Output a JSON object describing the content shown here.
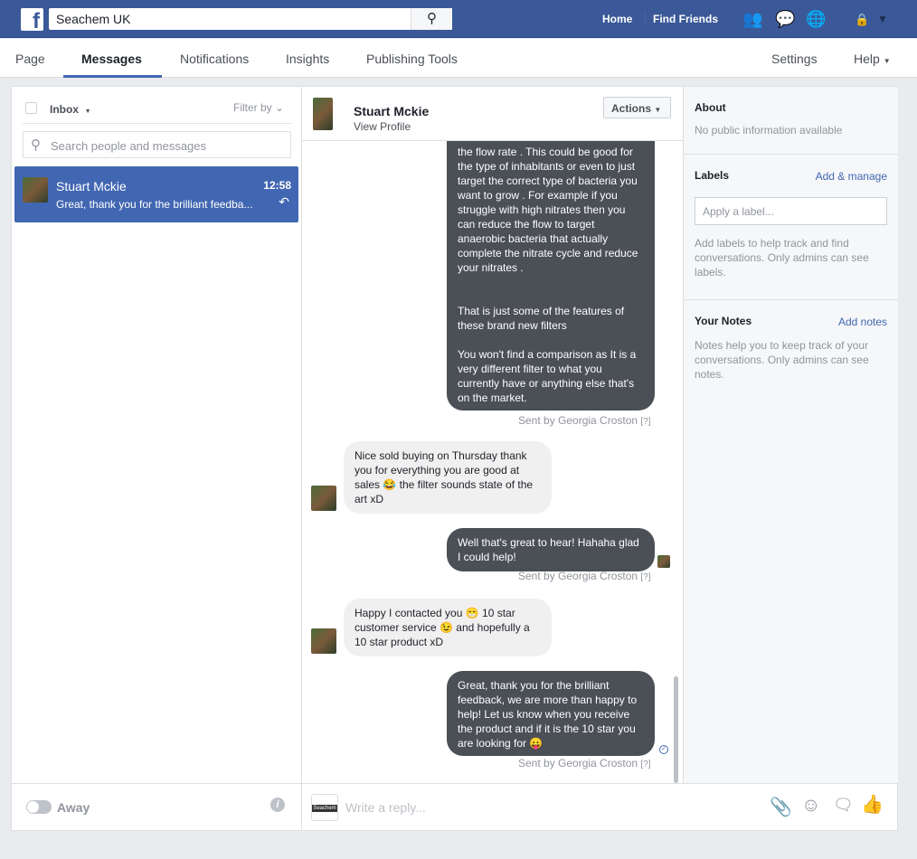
{
  "topbar": {
    "search_value": "Seachem UK",
    "nav": [
      "Home",
      "Find Friends"
    ]
  },
  "tabs": {
    "items": [
      "Page",
      "Messages",
      "Notifications",
      "Insights",
      "Publishing Tools"
    ],
    "right": [
      "Settings",
      "Help"
    ]
  },
  "inbox": {
    "label": "Inbox",
    "filter": "Filter by",
    "search_placeholder": "Search people and messages",
    "conversations": [
      {
        "name": "Stuart Mckie",
        "time": "12:58",
        "snippet": "Great, thank you for the brilliant feedba..."
      }
    ],
    "away_label": "Away"
  },
  "chat": {
    "name": "Stuart Mckie",
    "view_profile": "View Profile",
    "actions": "Actions",
    "messages": [
      {
        "dir": "out",
        "text": "the flow rate . This could be good for the type of inhabitants or even to just target the correct type of bacteria you want to grow . For example if you struggle with high nitrates then you can reduce the flow to target anaerobic bacteria that actually complete the nitrate cycle and reduce your nitrates .\n\n\nThat is just some of the features of these brand new filters\n\nYou won't find a comparison as It is a very different filter to what you currently have or anything else that's on the market.",
        "sent": "Sent by Georgia Croston",
        "q": "[?]"
      },
      {
        "dir": "in",
        "text": "Nice sold buying on Thursday thank you for everything you are good at sales 😂 the filter sounds state of the art xD"
      },
      {
        "dir": "out",
        "text": "Well that's great to hear! Hahaha glad I could help!",
        "sent": "Sent by Georgia Croston",
        "q": "[?]"
      },
      {
        "dir": "in",
        "text": "Happy I contacted you 😁 10 star customer service 😉 and hopefully a 10 star product xD"
      },
      {
        "dir": "out",
        "text": "Great, thank you for the brilliant feedback, we are more than happy to help! Let us know when you receive the product and if it is the 10 star you are looking for 😛",
        "sent": "Sent by Georgia Croston",
        "q": "[?]"
      }
    ],
    "reply_placeholder": "Write a reply..."
  },
  "about": {
    "title": "About",
    "text": "No public information available"
  },
  "labels": {
    "title": "Labels",
    "action": "Add & manage",
    "placeholder": "Apply a label...",
    "help": "Add labels to help track and find conversations. Only admins can see labels."
  },
  "notes": {
    "title": "Your Notes",
    "action": "Add notes",
    "help": "Notes help you to keep track of your conversations. Only admins can see notes."
  },
  "colors": {
    "brand": "#3b5998",
    "selected": "#4267b2",
    "bubble_out": "#4b4f56"
  }
}
